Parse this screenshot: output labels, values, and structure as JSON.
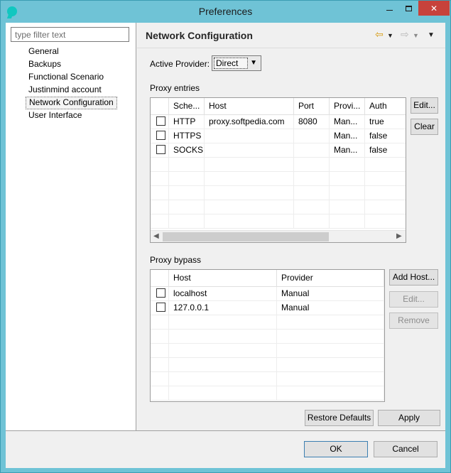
{
  "window": {
    "title": "Preferences",
    "close_label": "✕"
  },
  "filter": {
    "placeholder": "type filter text"
  },
  "nav_items": [
    {
      "label": "General"
    },
    {
      "label": "Backups"
    },
    {
      "label": "Functional Scenario"
    },
    {
      "label": "Justinmind account"
    },
    {
      "label": "Network Configuration",
      "selected": true
    },
    {
      "label": "User Interface"
    }
  ],
  "page": {
    "heading": "Network Configuration",
    "active_provider_label": "Active Provider:",
    "active_provider_value": "Direct",
    "proxy_entries_label": "Proxy entries",
    "proxy_bypass_label": "Proxy bypass"
  },
  "proxy_entries": {
    "columns": [
      "",
      "Sche...",
      "Host",
      "Port",
      "Provi...",
      "Auth"
    ],
    "rows": [
      {
        "scheme": "HTTP",
        "host": "proxy.softpedia.com",
        "port": "8080",
        "provider": "Man...",
        "auth": "true"
      },
      {
        "scheme": "HTTPS",
        "host": "",
        "port": "",
        "provider": "Man...",
        "auth": "false"
      },
      {
        "scheme": "SOCKS",
        "host": "",
        "port": "",
        "provider": "Man...",
        "auth": "false"
      }
    ],
    "edit_button": "Edit...",
    "clear_button": "Clear"
  },
  "proxy_bypass": {
    "columns": [
      "",
      "Host",
      "Provider"
    ],
    "rows": [
      {
        "host": "localhost",
        "provider": "Manual"
      },
      {
        "host": "127.0.0.1",
        "provider": "Manual"
      }
    ],
    "add_host_button": "Add Host...",
    "edit_button": "Edit...",
    "remove_button": "Remove"
  },
  "buttons": {
    "restore_defaults": "Restore Defaults",
    "apply": "Apply",
    "ok": "OK",
    "cancel": "Cancel"
  },
  "icons": {
    "back": "back-arrow-icon",
    "forward": "forward-arrow-icon"
  },
  "colors": {
    "titlebar": "#6fc3d6",
    "close_button": "#c7423b"
  }
}
